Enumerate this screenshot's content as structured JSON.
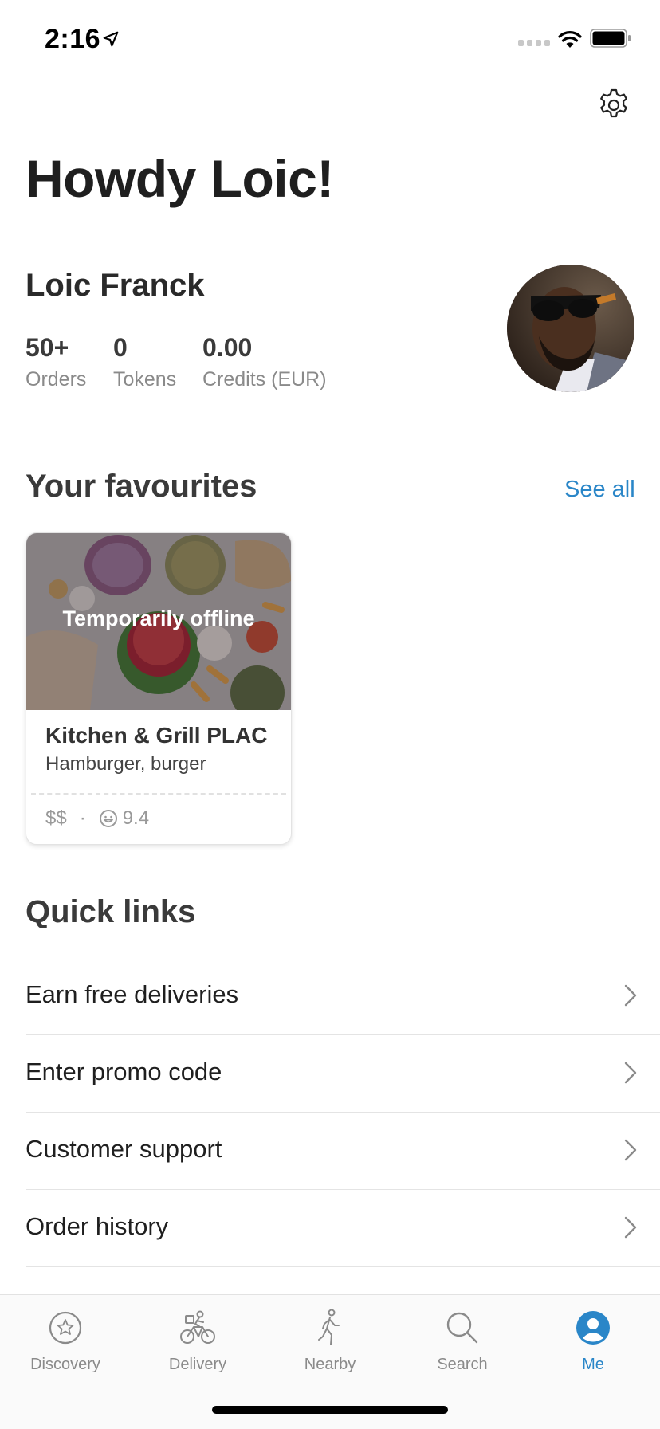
{
  "status_bar": {
    "time": "2:16"
  },
  "header": {
    "greeting": "Howdy Loic!",
    "settings_icon": "gear-icon"
  },
  "profile": {
    "name": "Loic Franck",
    "stats": [
      {
        "value": "50+",
        "label": "Orders"
      },
      {
        "value": "0",
        "label": "Tokens"
      },
      {
        "value": "0.00",
        "label": "Credits (EUR)"
      }
    ]
  },
  "favourites": {
    "title": "Your favourites",
    "see_all": "See all",
    "cards": [
      {
        "status": "Temporarily offline",
        "name": "Kitchen & Grill PLAC",
        "cuisine": "Hamburger, burger",
        "price": "$$",
        "separator": "·",
        "rating": "9.4"
      }
    ]
  },
  "quick_links": {
    "title": "Quick links",
    "items": [
      {
        "label": "Earn free deliveries"
      },
      {
        "label": "Enter promo code"
      },
      {
        "label": "Customer support"
      },
      {
        "label": "Order history"
      }
    ]
  },
  "tab_bar": {
    "tabs": [
      {
        "label": "Discovery",
        "icon": "star-circle-icon"
      },
      {
        "label": "Delivery",
        "icon": "bicycle-courier-icon"
      },
      {
        "label": "Nearby",
        "icon": "walking-person-icon"
      },
      {
        "label": "Search",
        "icon": "search-icon"
      },
      {
        "label": "Me",
        "icon": "user-icon"
      }
    ],
    "active_color": "#2a86c8",
    "inactive_color": "#8a8a8a"
  }
}
